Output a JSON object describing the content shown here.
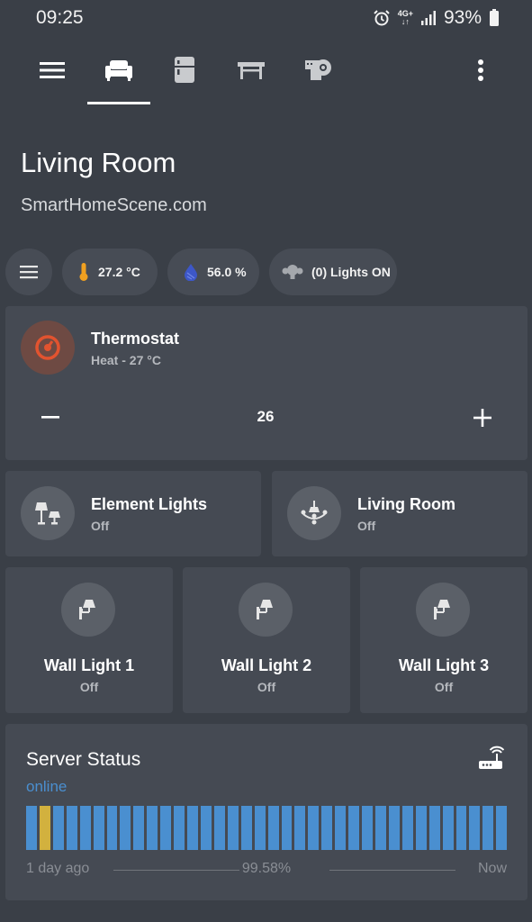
{
  "status_bar": {
    "time": "09:25",
    "network": "4G+",
    "battery": "93%"
  },
  "nav": {
    "tabs": [
      {
        "icon": "sofa-icon",
        "active": true
      },
      {
        "icon": "fridge-icon",
        "active": false
      },
      {
        "icon": "table-icon",
        "active": false
      },
      {
        "icon": "ceiling-projector-icon",
        "active": false
      }
    ]
  },
  "page": {
    "title": "Living Room",
    "subtitle": "SmartHomeScene.com"
  },
  "chips": {
    "temperature": "27.2 °C",
    "humidity": "56.0 %",
    "lights": "(0) Lights ON"
  },
  "thermostat": {
    "name": "Thermostat",
    "state": "Heat - 27 °C",
    "setpoint": "26",
    "accent_color": "#e2532f"
  },
  "light_groups": [
    {
      "name": "Element Lights",
      "state": "Off"
    },
    {
      "name": "Living Room",
      "state": "Off"
    }
  ],
  "wall_lights": [
    {
      "name": "Wall Light 1",
      "state": "Off"
    },
    {
      "name": "Wall Light 2",
      "state": "Off"
    },
    {
      "name": "Wall Light 3",
      "state": "Off"
    }
  ],
  "server": {
    "title": "Server Status",
    "state": "online",
    "uptime": "99.58%",
    "from_label": "1 day ago",
    "to_label": "Now",
    "bar_count": 36,
    "warn_index": 1,
    "ok_color": "#4a8fd0",
    "warn_color": "#d2b13e"
  }
}
